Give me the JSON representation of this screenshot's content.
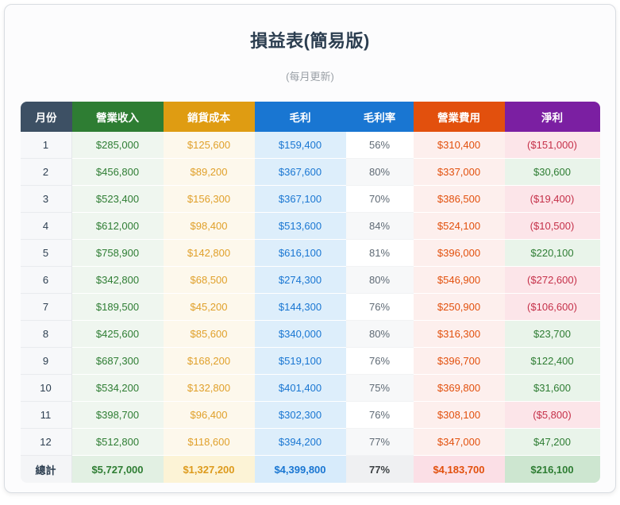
{
  "title": "損益表(簡易版)",
  "subtitle": "(每月更新)",
  "colors": {
    "header_month": "#3d5064",
    "header_revenue": "#2e7d33",
    "header_cost": "#df9c12",
    "header_gross": "#1976d2",
    "header_rate": "#1976d2",
    "header_opex": "#e2500d",
    "header_net": "#7b1fa2",
    "positive_text": "#2e7d33",
    "negative_text": "#c53049"
  },
  "table": {
    "columns": [
      {
        "key": "month",
        "label": "月份"
      },
      {
        "key": "revenue",
        "label": "營業收入"
      },
      {
        "key": "cost",
        "label": "銷貨成本"
      },
      {
        "key": "gross",
        "label": "毛利"
      },
      {
        "key": "rate",
        "label": "毛利率"
      },
      {
        "key": "opex",
        "label": "營業費用"
      },
      {
        "key": "net",
        "label": "淨利"
      }
    ],
    "rows": [
      {
        "month": "1",
        "revenue": "$285,000",
        "cost": "$125,600",
        "gross": "$159,400",
        "rate": "56%",
        "opex": "$310,400",
        "net": "($151,000)"
      },
      {
        "month": "2",
        "revenue": "$456,800",
        "cost": "$89,200",
        "gross": "$367,600",
        "rate": "80%",
        "opex": "$337,000",
        "net": "$30,600"
      },
      {
        "month": "3",
        "revenue": "$523,400",
        "cost": "$156,300",
        "gross": "$367,100",
        "rate": "70%",
        "opex": "$386,500",
        "net": "($19,400)"
      },
      {
        "month": "4",
        "revenue": "$612,000",
        "cost": "$98,400",
        "gross": "$513,600",
        "rate": "84%",
        "opex": "$524,100",
        "net": "($10,500)"
      },
      {
        "month": "5",
        "revenue": "$758,900",
        "cost": "$142,800",
        "gross": "$616,100",
        "rate": "81%",
        "opex": "$396,000",
        "net": "$220,100"
      },
      {
        "month": "6",
        "revenue": "$342,800",
        "cost": "$68,500",
        "gross": "$274,300",
        "rate": "80%",
        "opex": "$546,900",
        "net": "($272,600)"
      },
      {
        "month": "7",
        "revenue": "$189,500",
        "cost": "$45,200",
        "gross": "$144,300",
        "rate": "76%",
        "opex": "$250,900",
        "net": "($106,600)"
      },
      {
        "month": "8",
        "revenue": "$425,600",
        "cost": "$85,600",
        "gross": "$340,000",
        "rate": "80%",
        "opex": "$316,300",
        "net": "$23,700"
      },
      {
        "month": "9",
        "revenue": "$687,300",
        "cost": "$168,200",
        "gross": "$519,100",
        "rate": "76%",
        "opex": "$396,700",
        "net": "$122,400"
      },
      {
        "month": "10",
        "revenue": "$534,200",
        "cost": "$132,800",
        "gross": "$401,400",
        "rate": "75%",
        "opex": "$369,800",
        "net": "$31,600"
      },
      {
        "month": "11",
        "revenue": "$398,700",
        "cost": "$96,400",
        "gross": "$302,300",
        "rate": "76%",
        "opex": "$308,100",
        "net": "($5,800)"
      },
      {
        "month": "12",
        "revenue": "$512,800",
        "cost": "$118,600",
        "gross": "$394,200",
        "rate": "77%",
        "opex": "$347,000",
        "net": "$47,200"
      }
    ],
    "total": {
      "month": "總計",
      "revenue": "$5,727,000",
      "cost": "$1,327,200",
      "gross": "$4,399,800",
      "rate": "77%",
      "opex": "$4,183,700",
      "net": "$216,100"
    }
  }
}
